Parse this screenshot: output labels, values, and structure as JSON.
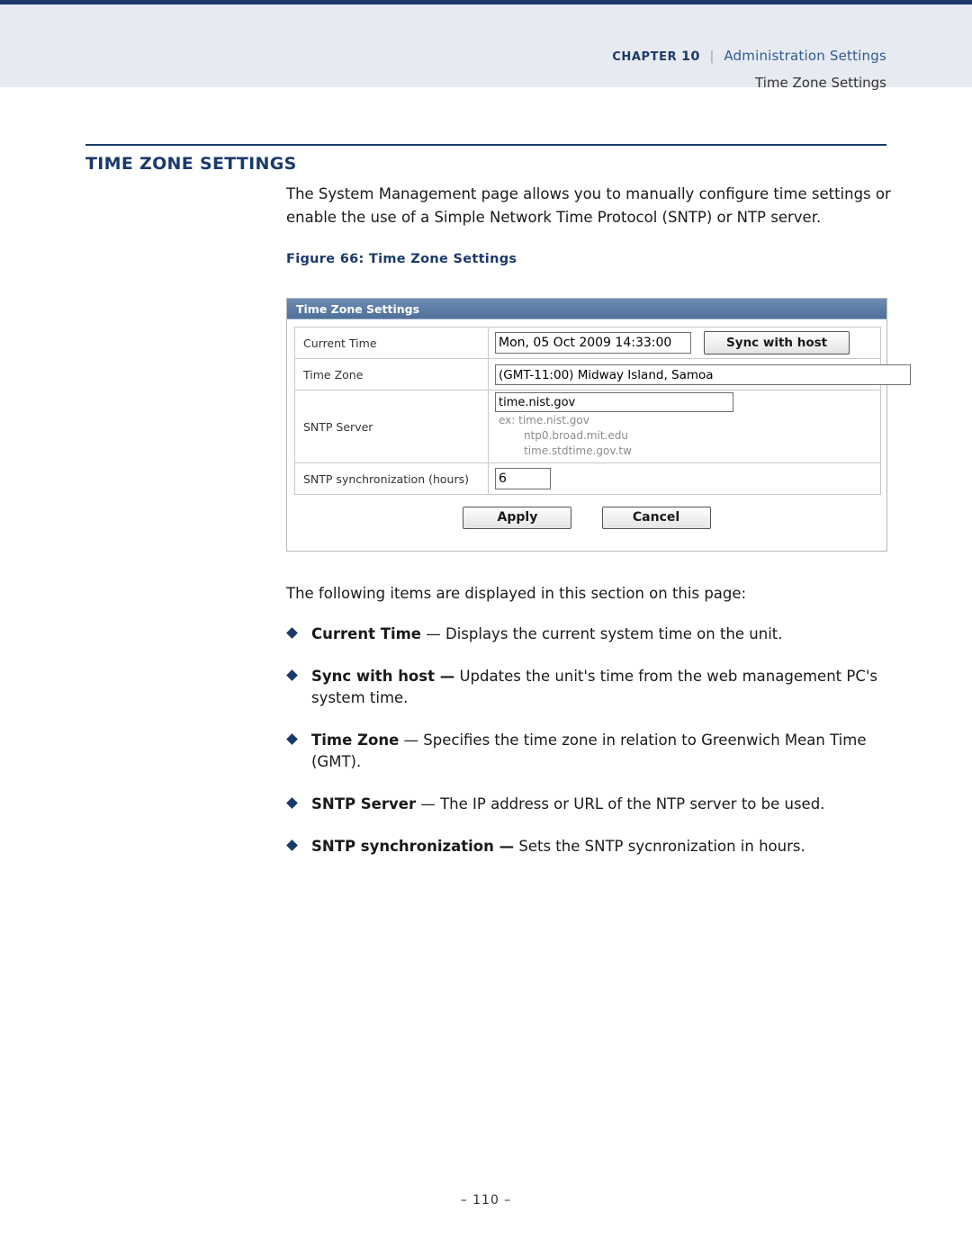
{
  "header": {
    "chapter_word": "CHAPTER",
    "chapter_number": "10",
    "separator": "|",
    "chapter_title": "Administration Settings",
    "subtitle": "Time Zone Settings"
  },
  "section": {
    "title_first": "T",
    "title_rest": "IME ",
    "title": "TIME ZONE SETTINGS"
  },
  "body": {
    "intro": "The System Management page allows you to manually configure time settings or enable the use of a Simple Network Time Protocol (SNTP) or NTP server.",
    "figure_caption": "Figure 66:  Time Zone Settings",
    "following": "The following items are displayed in this section on this page:"
  },
  "screenshot": {
    "title": "Time Zone Settings",
    "rows": {
      "current_time_label": "Current Time",
      "current_time_value": "Mon, 05 Oct 2009 14:33:00",
      "sync_button": "Sync with host",
      "time_zone_label": "Time Zone",
      "time_zone_value": "(GMT-11:00) Midway Island, Samoa",
      "sntp_server_label": "SNTP Server",
      "sntp_server_value": "time.nist.gov",
      "sntp_hint_1": "ex: time.nist.gov",
      "sntp_hint_2": "ntp0.broad.mit.edu",
      "sntp_hint_3": "time.stdtime.gov.tw",
      "sntp_sync_label": "SNTP synchronization (hours)",
      "sntp_sync_value": "6"
    },
    "buttons": {
      "apply": "Apply",
      "cancel": "Cancel"
    }
  },
  "bullets": [
    {
      "term": "Current Time",
      "dash": " — ",
      "text": "Displays the current system time on the unit."
    },
    {
      "term": "Sync with host —",
      "dash": " ",
      "text": "Updates the unit's time from the web management PC's system time."
    },
    {
      "term": "Time Zone",
      "dash": " — ",
      "text": "Specifies the time zone in relation to Greenwich Mean Time (GMT)."
    },
    {
      "term": "SNTP Server",
      "dash": " — ",
      "text": "The IP address or URL of the NTP server to be used."
    },
    {
      "term": "SNTP synchronization —",
      "dash": " ",
      "text": "Sets the SNTP sycnronization in hours."
    }
  ],
  "footer": {
    "page_number": "–  110  –"
  }
}
